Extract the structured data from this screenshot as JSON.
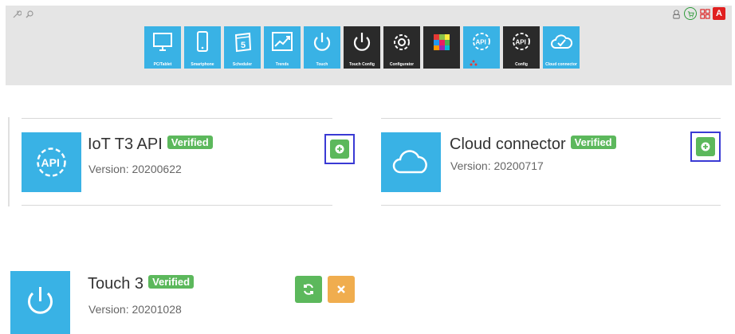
{
  "toolbar": {
    "admin_badge": "A",
    "apps": [
      {
        "label": "PC/Tablet",
        "icon": "monitor-icon",
        "theme": "blue"
      },
      {
        "label": "Smartphone",
        "icon": "smartphone-icon",
        "theme": "blue"
      },
      {
        "label": "Scheduler",
        "icon": "calendar-icon",
        "theme": "blue"
      },
      {
        "label": "Trends",
        "icon": "trend-chart-icon",
        "theme": "blue"
      },
      {
        "label": "Touch",
        "icon": "power-icon",
        "theme": "blue"
      },
      {
        "label": "Touch Config",
        "icon": "power-icon",
        "theme": "dark"
      },
      {
        "label": "Configurator",
        "icon": "gear-icon",
        "theme": "dark"
      },
      {
        "label": "",
        "icon": "color-grid-icon",
        "theme": "dark"
      },
      {
        "label": "",
        "icon": "api-gear-icon",
        "theme": "blue"
      },
      {
        "label": "Config",
        "icon": "api-gear-icon",
        "theme": "dark"
      },
      {
        "label": "Cloud connector",
        "icon": "cloud-check-icon",
        "theme": "blue"
      }
    ]
  },
  "cards": [
    {
      "title": "IoT T3 API",
      "badge": "Verified",
      "version": "Version: 20200622",
      "icon": "api-gear-icon"
    },
    {
      "title": "Cloud connector",
      "badge": "Verified",
      "version": "Version: 20200717",
      "icon": "cloud-icon"
    },
    {
      "title": "Touch 3",
      "badge": "Verified",
      "version": "Version: 20201028",
      "icon": "power-icon"
    }
  ],
  "colors": {
    "accent": "#39b2e5",
    "success": "#5cb85c",
    "warning": "#f0ad4e",
    "highlight": "#3a3ad4"
  }
}
